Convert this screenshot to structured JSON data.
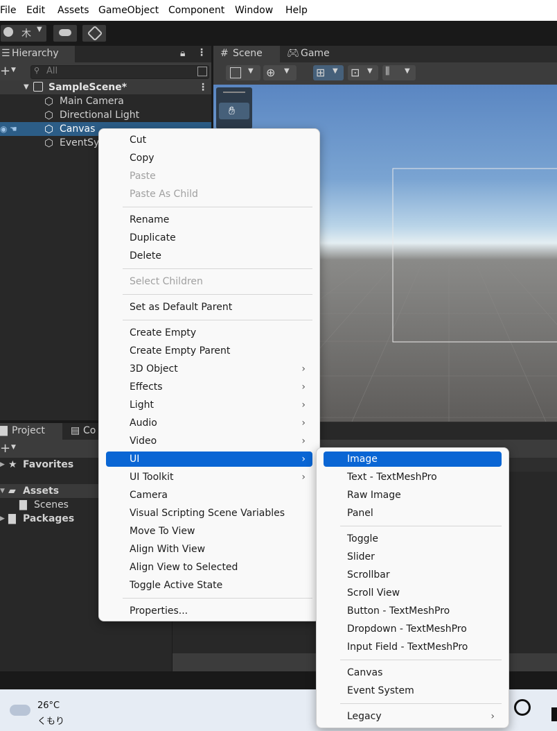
{
  "menubar": [
    "File",
    "Edit",
    "Assets",
    "GameObject",
    "Component",
    "Window",
    "Help"
  ],
  "toolbar": {
    "account_label": "木"
  },
  "hierarchy": {
    "tab": "Hierarchy",
    "search_placeholder": "All",
    "scene": "SampleScene*",
    "items": [
      "Main Camera",
      "Directional Light",
      "Canvas",
      "EventSy"
    ]
  },
  "scene_tabs": [
    "Scene",
    "Game"
  ],
  "project": {
    "tabs": [
      "Project",
      "Co"
    ],
    "tree": [
      "Favorites",
      "Assets",
      "Scenes",
      "Packages"
    ]
  },
  "context_menu": {
    "items": [
      "Cut",
      "Copy",
      "Paste",
      "Paste As Child",
      "Rename",
      "Duplicate",
      "Delete",
      "Select Children",
      "Set as Default Parent",
      "Create Empty",
      "Create Empty Parent",
      "3D Object",
      "Effects",
      "Light",
      "Audio",
      "Video",
      "UI",
      "UI Toolkit",
      "Camera",
      "Visual Scripting Scene Variables",
      "Move To View",
      "Align With View",
      "Align View to Selected",
      "Toggle Active State",
      "Properties..."
    ]
  },
  "ui_submenu": {
    "items": [
      "Image",
      "Text - TextMeshPro",
      "Raw Image",
      "Panel",
      "Toggle",
      "Slider",
      "Scrollbar",
      "Scroll View",
      "Button - TextMeshPro",
      "Dropdown - TextMeshPro",
      "Input Field - TextMeshPro",
      "Canvas",
      "Event System",
      "Legacy"
    ]
  },
  "weather": {
    "temp": "26°C",
    "desc": "くもり"
  },
  "colors": {
    "highlight": "#0a66d4",
    "selection": "#2c5d87"
  }
}
